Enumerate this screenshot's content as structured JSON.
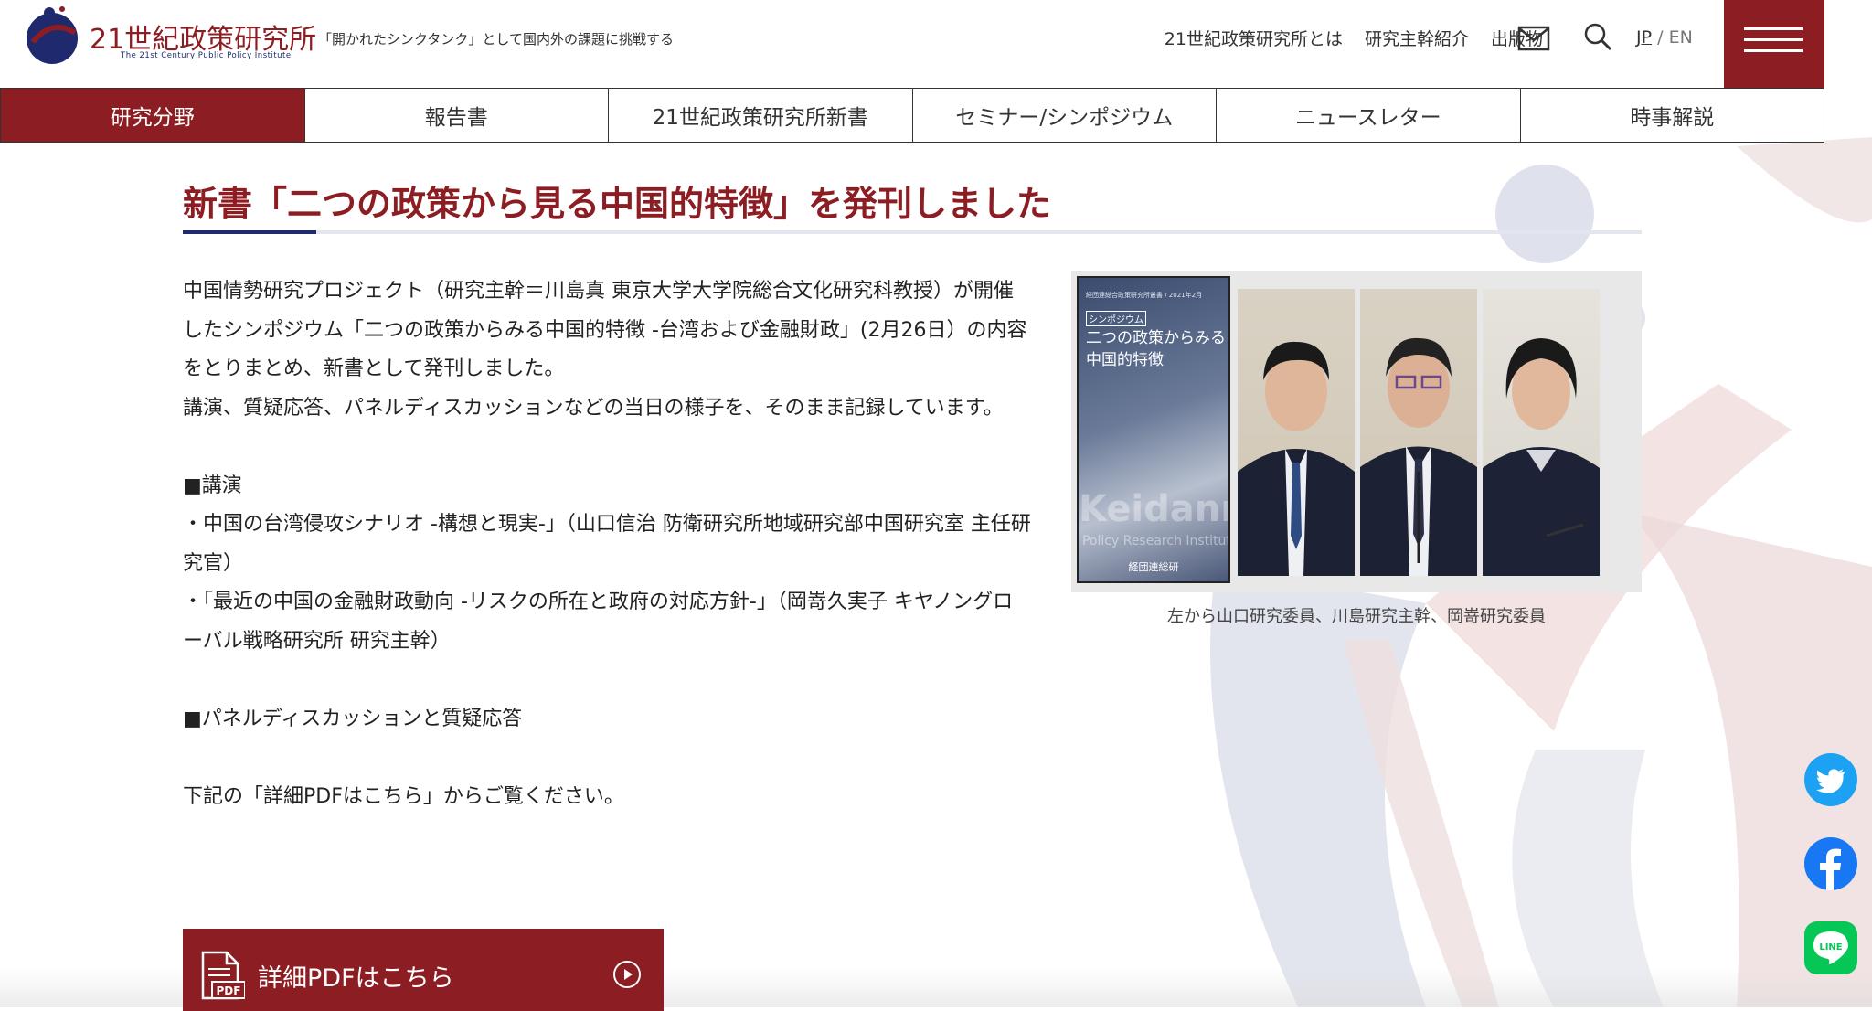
{
  "header": {
    "site_name": "21世紀政策研究所",
    "site_name_en": "The 21st Century Public Policy Institute",
    "tagline": "「開かれたシンクタンク」として国内外の課題に挑戦する",
    "nav": [
      "21世紀政策研究所とは",
      "研究主幹紹介",
      "出版物"
    ],
    "lang_jp": "JP",
    "lang_sep": "/",
    "lang_en": "EN",
    "icons": [
      "mail-icon",
      "search-icon",
      "menu-icon"
    ],
    "accent_color": "#8c1d22",
    "navy_color": "#1f2a6e"
  },
  "categories": [
    {
      "label": "研究分野",
      "active": true
    },
    {
      "label": "報告書",
      "active": false
    },
    {
      "label": "21世紀政策研究所新書",
      "active": false
    },
    {
      "label": "セミナー/シンポジウム",
      "active": false
    },
    {
      "label": "ニュースレター",
      "active": false
    },
    {
      "label": "時事解説",
      "active": false
    }
  ],
  "article": {
    "title": "新書「二つの政策から見る中国的特徴」を発刊しました",
    "intro": [
      "中国情勢研究プロジェクト（研究主幹＝川島真 東京大学大学院総合文化研究科教授）が開催したシンポジウム「二つの政策からみる中国的特徴 -台湾および金融財政」(2月26日）の内容をとりまとめ、新書として発刊しました。",
      "講演、質疑応答、パネルディスカッションなどの当日の様子を、そのまま記録しています。"
    ],
    "lecture_heading": "■講演",
    "lectures": [
      "・中国の台湾侵攻シナリオ -構想と現実-」（山口信治 防衛研究所地域研究部中国研究室 主任研究官）",
      "・「最近の中国の金融財政動向 -リスクの所在と政府の対応方針-」（岡嵜久実子 キヤノングローバル戦略研究所 研究主幹）"
    ],
    "panel_heading": "■パネルディスカッションと質疑応答",
    "pdf_note": "下記の「詳細PDFはこちら」からご覧ください。",
    "pdf_button": "詳細PDFはこちら",
    "pdf_icon_text": "PDF"
  },
  "figure": {
    "cover_series": "経団連総合政策研究所叢書 / 2021年2月",
    "cover_tag": "シンポジウム",
    "cover_title_line1": "二つの政策からみる",
    "cover_title_line2": "中国的特徴",
    "cover_watermark": "Keidanren",
    "cover_watermark_sub": "Policy Research Institute",
    "cover_publisher": "経団連総研",
    "caption": "左から山口研究委員、川島研究主幹、岡嵜研究委員"
  },
  "social": [
    "twitter-icon",
    "facebook-icon",
    "line-icon"
  ],
  "line_label": "LINE"
}
